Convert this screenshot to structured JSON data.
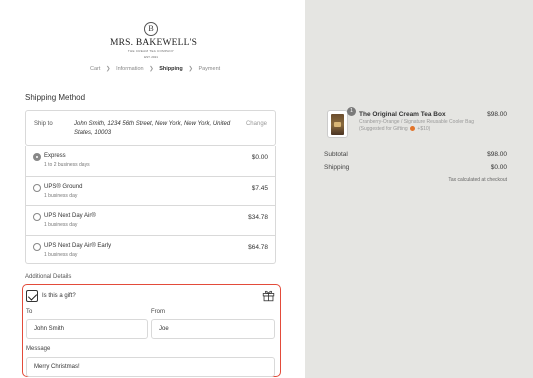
{
  "brand": {
    "crest_letter": "B",
    "name": "MRS. BAKEWELL'S",
    "tagline": "THE CREAM TEA COMPANY",
    "established": "EST. 2021"
  },
  "breadcrumb": {
    "items": [
      "Cart",
      "Information",
      "Shipping",
      "Payment"
    ],
    "active": "Shipping"
  },
  "shipping_method": {
    "heading": "Shipping Method",
    "ship_to_label": "Ship to",
    "ship_to_address": "John Smith, 1234 56th Street, New York, New York, United States, 10003",
    "change_label": "Change",
    "options": [
      {
        "name": "Express",
        "detail": "1 to 2 business days",
        "price": "$0.00",
        "selected": true
      },
      {
        "name": "UPS® Ground",
        "detail": "1 business day",
        "price": "$7.45",
        "selected": false
      },
      {
        "name": "UPS Next Day Air®",
        "detail": "1 business day",
        "price": "$34.78",
        "selected": false
      },
      {
        "name": "UPS Next Day Air® Early",
        "detail": "1 business day",
        "price": "$64.78",
        "selected": false
      }
    ]
  },
  "additional_details": {
    "heading": "Additional Details",
    "gift_question": "Is this a gift?",
    "gift_checked": true,
    "to_label": "To",
    "to_value": "John Smith",
    "from_label": "From",
    "from_value": "Joe",
    "message_label": "Message",
    "message_value": "Merry Christmas!"
  },
  "order_summary": {
    "item": {
      "quantity": "1",
      "title": "The Original Cream Tea Box",
      "variant": "Cranberry-Orange / Signature Reusable Cooler Bag",
      "note_prefix": "(Suggested for Gifting",
      "note_suffix": "+$10)",
      "price": "$98.00"
    },
    "subtotal_label": "Subtotal",
    "subtotal_value": "$98.00",
    "shipping_label": "Shipping",
    "shipping_value": "$0.00",
    "tax_note": "Tax calculated at checkout"
  },
  "colors": {
    "highlight_border": "#e34b3a",
    "sidebar_background": "#e5e5e2"
  }
}
